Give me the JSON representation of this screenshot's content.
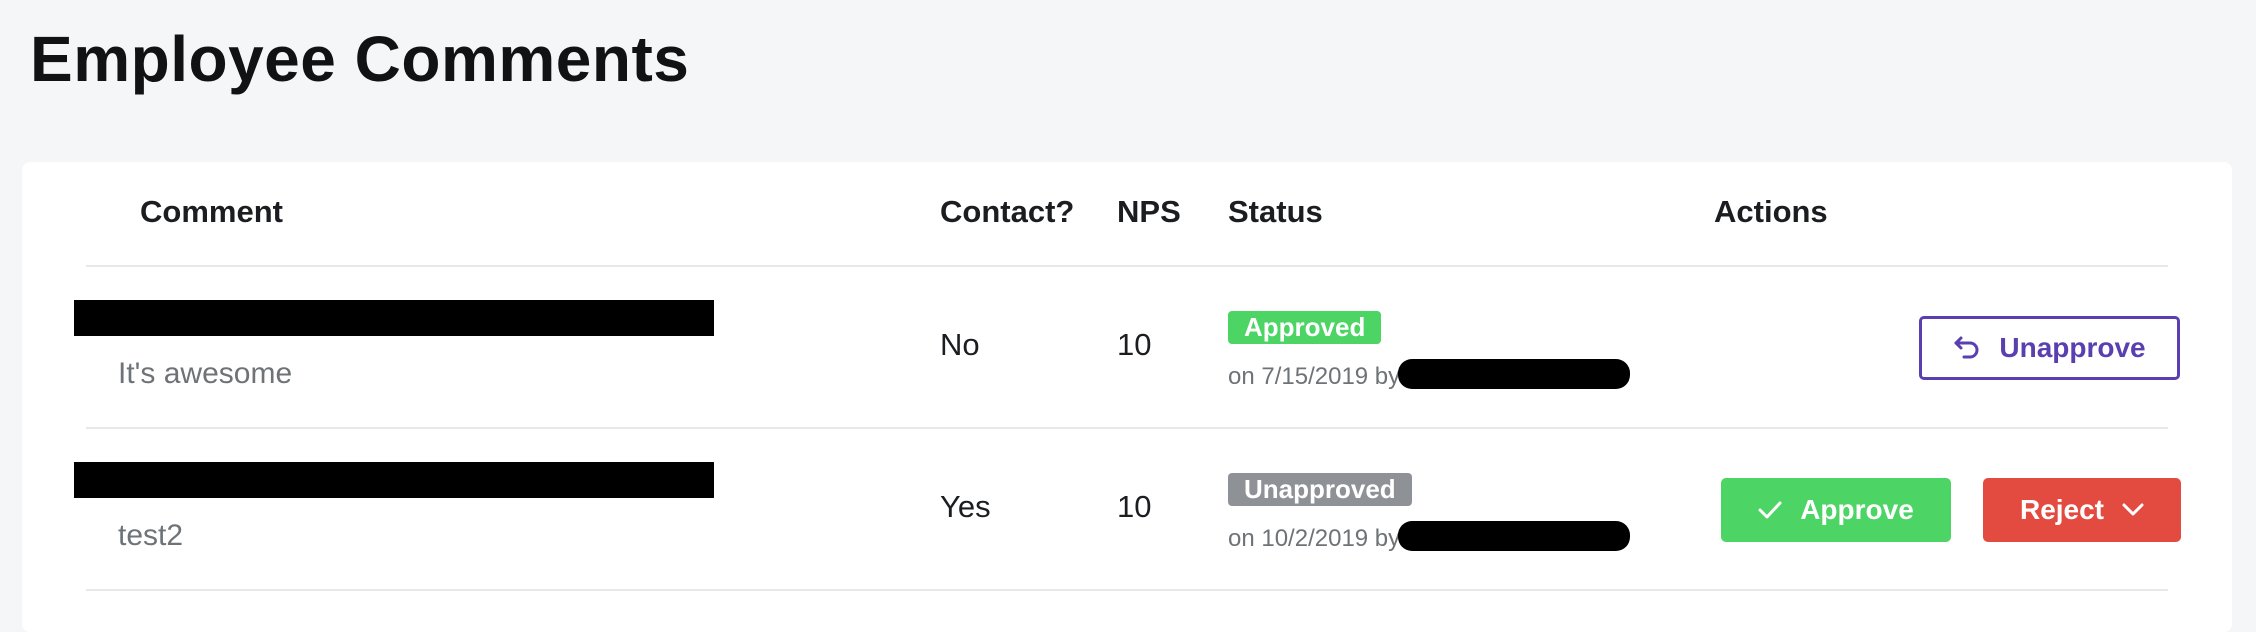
{
  "page": {
    "title": "Employee Comments"
  },
  "table": {
    "headers": {
      "comment": "Comment",
      "contact": "Contact?",
      "nps": "NPS",
      "status": "Status",
      "actions": "Actions"
    },
    "rows": [
      {
        "comment": "It's awesome",
        "contact": "No",
        "nps": "10",
        "status": {
          "label": "Approved",
          "meta": "on 7/15/2019 by"
        },
        "actions": {
          "unapprove": "Unapprove"
        }
      },
      {
        "comment": "test2",
        "contact": "Yes",
        "nps": "10",
        "status": {
          "label": "Unapproved",
          "meta": "on 10/2/2019 by"
        },
        "actions": {
          "approve": "Approve",
          "reject": "Reject"
        }
      }
    ]
  },
  "colors": {
    "approved": "#4cd465",
    "unapproved": "#8e9296",
    "reject": "#e34b40",
    "accent": "#5a3fb0"
  },
  "icons": {
    "undo": "undo-arrow-icon",
    "check": "check-icon",
    "chevron": "chevron-down-icon"
  }
}
